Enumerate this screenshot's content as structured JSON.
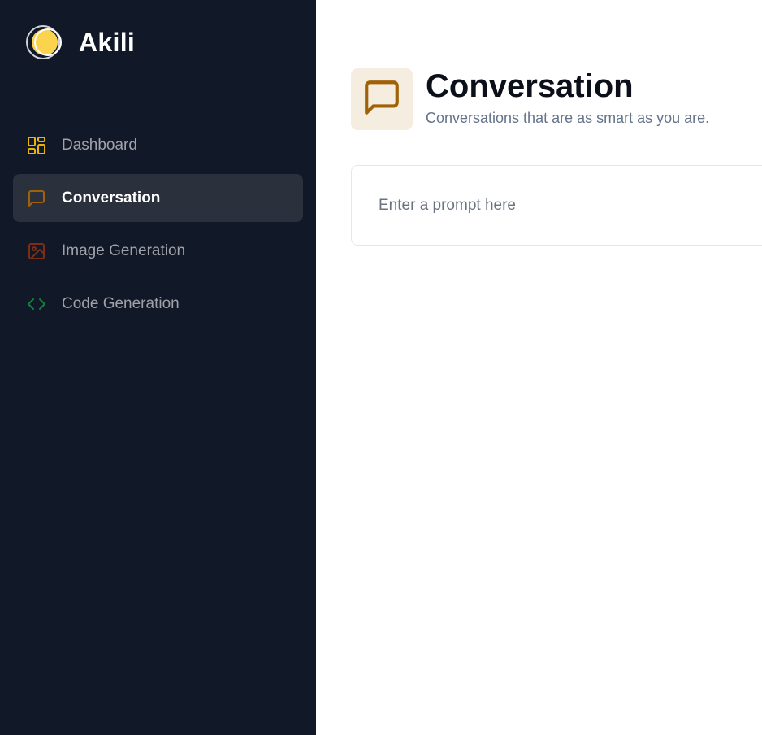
{
  "brand": {
    "name": "Akili",
    "logo_icon": "overlapping-circles-logo"
  },
  "sidebar": {
    "items": [
      {
        "label": "Dashboard",
        "icon": "layout-dashboard-icon",
        "color": "#eab308",
        "active": false
      },
      {
        "label": "Conversation",
        "icon": "message-square-icon",
        "color": "#a16207",
        "active": true
      },
      {
        "label": "Image Generation",
        "icon": "image-icon",
        "color": "#7c2d12",
        "active": false
      },
      {
        "label": "Code Generation",
        "icon": "code-icon",
        "color": "#15803d",
        "active": false
      }
    ]
  },
  "header": {
    "title": "Conversation",
    "subtitle": "Conversations that are as smart as you are.",
    "icon": "message-square-icon",
    "icon_color": "#a16207",
    "icon_bg": "#f6ede1"
  },
  "prompt": {
    "placeholder": "Enter a prompt here",
    "value": ""
  },
  "colors": {
    "sidebar_bg": "#111827",
    "active_item_bg": "#2a303c",
    "logo_yellow": "#fcd34d"
  }
}
